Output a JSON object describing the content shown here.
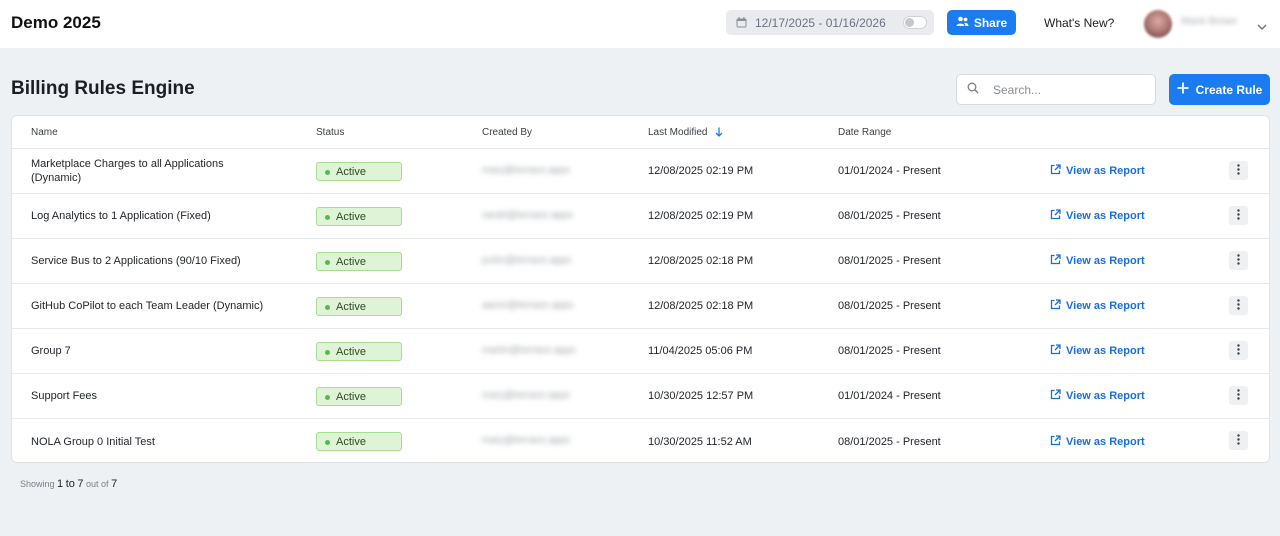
{
  "app": {
    "title": "Demo 2025",
    "date_range": "12/17/2025 - 01/16/2026",
    "share_label": "Share",
    "whats_new_label": "What's New?",
    "user_name": "Marie Brown"
  },
  "page": {
    "title": "Billing Rules Engine",
    "search_placeholder": "Search...",
    "create_label": "Create Rule"
  },
  "table": {
    "headers": {
      "name": "Name",
      "status": "Status",
      "created_by": "Created By",
      "last_modified": "Last Modified",
      "date_range": "Date Range"
    },
    "rows": [
      {
        "name": "Marketplace Charges to all Applications (Dynamic)",
        "status": "Active",
        "created_by": "mary@terrace.apps",
        "last_modified": "12/08/2025 02:19 PM",
        "date_range": "01/01/2024 - Present",
        "action": "View as Report"
      },
      {
        "name": "Log Analytics to 1 Application (Fixed)",
        "status": "Active",
        "created_by": "sarah@terrace.apps",
        "last_modified": "12/08/2025 02:19 PM",
        "date_range": "08/01/2025 - Present",
        "action": "View as Report"
      },
      {
        "name": "Service Bus to 2 Applications (90/10 Fixed)",
        "status": "Active",
        "created_by": "justin@terrace.apps",
        "last_modified": "12/08/2025 02:18 PM",
        "date_range": "08/01/2025 - Present",
        "action": "View as Report"
      },
      {
        "name": "GitHub CoPilot to each Team Leader (Dynamic)",
        "status": "Active",
        "created_by": "aaron@terrace.apps",
        "last_modified": "12/08/2025 02:18 PM",
        "date_range": "08/01/2025 - Present",
        "action": "View as Report"
      },
      {
        "name": "Group 7",
        "status": "Active",
        "created_by": "martin@terrace.apps",
        "last_modified": "11/04/2025 05:06 PM",
        "date_range": "08/01/2025 - Present",
        "action": "View as Report"
      },
      {
        "name": "Support Fees",
        "status": "Active",
        "created_by": "mary@terrace.apps",
        "last_modified": "10/30/2025 12:57 PM",
        "date_range": "01/01/2024 - Present",
        "action": "View as Report"
      },
      {
        "name": "NOLA Group 0 Initial Test",
        "status": "Active",
        "created_by": "mary@terrace.apps",
        "last_modified": "10/30/2025 11:52 AM",
        "date_range": "08/01/2025 - Present",
        "action": "View as Report"
      }
    ]
  },
  "pager": {
    "showing": "Showing",
    "from": "1",
    "to_word": "to",
    "to": "7",
    "out_of": "out of",
    "total": "7"
  },
  "colors": {
    "accent": "#1a7cf0",
    "link": "#1a6ed8",
    "badge_bg": "#dff4d6",
    "badge_border": "#a6dd8e"
  }
}
